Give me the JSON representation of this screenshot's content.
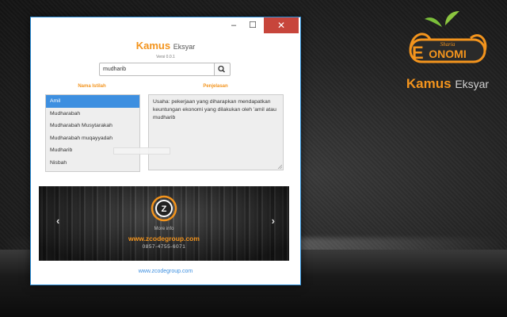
{
  "window": {
    "minimize_glyph": "–",
    "maximize_glyph": "☐",
    "close_glyph": "✕"
  },
  "app": {
    "title": "Kamus",
    "title_sub": "Eksyar",
    "version": "Versi 0.0.1"
  },
  "search": {
    "value": "mudharib",
    "icon": "search-icon"
  },
  "columns": {
    "left_header": "Nama Istilah",
    "right_header": "Penjelasan"
  },
  "terms": [
    {
      "label": "Amil",
      "selected": true
    },
    {
      "label": "Mudharabah",
      "selected": false
    },
    {
      "label": "Mudharabah Musytarakah",
      "selected": false
    },
    {
      "label": "Mudharabah muqayyadah",
      "selected": false
    },
    {
      "label": "Mudharib",
      "selected": false
    },
    {
      "label": "Nisbah",
      "selected": false
    }
  ],
  "explanation": "Usaha: pekerjaan yang diharapkan mendapatkan keuntungan ekonomi yang dilakukan oleh 'amil atau mudharib",
  "banner": {
    "more_info": "More info",
    "url": "www.zcodegroup.com",
    "phone": "0857-4755-6071",
    "prev_glyph": "‹",
    "next_glyph": "›"
  },
  "footer": {
    "link": "www.zcodegroup.com"
  },
  "brand": {
    "logo_text_top": "Sharia",
    "logo_text_main": "ONOMI",
    "title": "Kamus",
    "title_sub": "Eksyar"
  },
  "colors": {
    "accent": "#f3941d",
    "selection": "#3d8fe0",
    "close": "#c7453b",
    "leaf": "#7bbf3a"
  }
}
